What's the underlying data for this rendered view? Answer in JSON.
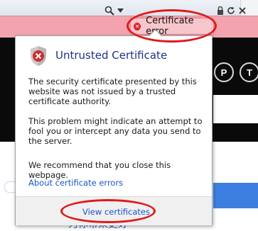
{
  "address_bar": {
    "tint_color": "#f2a3ad",
    "controls": {
      "search_icon": "search-icon",
      "dropdown_icon": "chevron-down-icon",
      "lock_icon": "lock-icon",
      "refresh_icon": "refresh-icon",
      "stop_icon": "close-icon"
    },
    "certificate_chip": {
      "label": "Certificate error",
      "icon": "error-x-icon"
    }
  },
  "background_page": {
    "circle_buttons": [
      "P",
      "T"
    ],
    "bottom_text": "为你带来更好"
  },
  "popup": {
    "title": "Untrusted Certificate",
    "icon": "shield-error-icon",
    "paragraphs": [
      "The security certificate presented by this website was not issued by a trusted certificate authority.",
      "This problem might indicate an attempt to fool you or intercept any data you send to the server.",
      "We recommend that you close this webpage."
    ],
    "about_link": "About certificate errors",
    "view_link": "View certificates"
  },
  "highlight_color": "#e01a1a"
}
